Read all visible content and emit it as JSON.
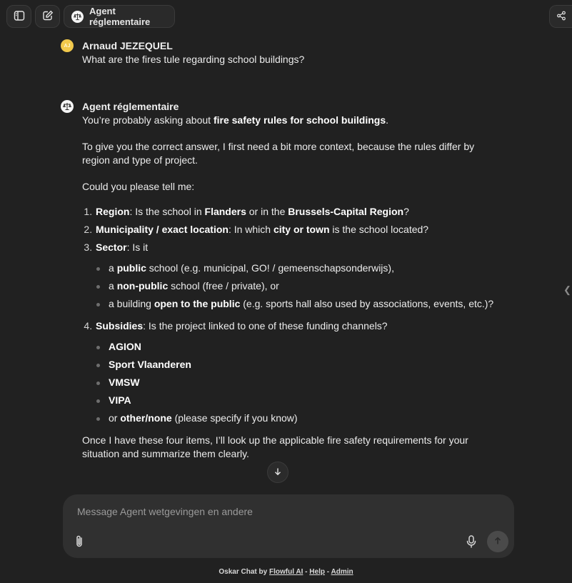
{
  "header": {
    "agent_name": "Agent réglementaire",
    "icons": {
      "sidebar": "sidebar-toggle-icon",
      "new_chat": "new-chat-icon",
      "agent": "scales-icon",
      "share": "share-icon"
    }
  },
  "messages": {
    "user": {
      "avatar_initials": "AJ",
      "author": "Arnaud JEZEQUEL",
      "text": "What are the fires tule regarding school buildings?"
    },
    "agent": {
      "author": "Agent réglementaire",
      "intro_pre": "You’re probably asking about ",
      "intro_bold": "fire safety rules for school buildings",
      "intro_post": ".",
      "context": "To give you the correct answer, I first need a bit more context, because the rules differ by region and type of project.",
      "ask": "Could you please tell me:",
      "q1": {
        "bold": "Region",
        "a": ": Is the school in ",
        "b1": "Flanders",
        "c": " or in the ",
        "b2": "Brussels-Capital Region",
        "d": "?"
      },
      "q2": {
        "bold": "Municipality / exact location",
        "a": ": In which ",
        "b1": "city or town",
        "c": " is the school located?"
      },
      "q3": {
        "bold": "Sector",
        "a": ": Is it",
        "opt1": {
          "pre": "a ",
          "bold": "public",
          "post": " school (e.g. municipal, GO! / gemeenschapsonderwijs),"
        },
        "opt2": {
          "pre": "a ",
          "bold": "non-public",
          "post": " school (free / private), or"
        },
        "opt3": {
          "pre": "a building ",
          "bold": "open to the public",
          "post": " (e.g. sports hall also used by associations, events, etc.)?"
        }
      },
      "q4": {
        "bold": "Subsidies",
        "a": ": Is the project linked to one of these funding channels?",
        "items": [
          "AGION",
          "Sport Vlaanderen",
          "VMSW",
          "VIPA"
        ],
        "last_pre": "or ",
        "last_bold": "other/none",
        "last_post": " (please specify if you know)"
      },
      "closing": "Once I have these four items, I’ll look up the applicable fire safety requirements for your situation and summarize them clearly."
    }
  },
  "composer": {
    "placeholder": "Message Agent wetgevingen en andere",
    "icons": {
      "attach": "paperclip-icon",
      "mic": "microphone-icon",
      "send": "arrow-up-icon",
      "scroll": "arrow-down-icon"
    }
  },
  "footer": {
    "prefix": "Oskar Chat by ",
    "link1": "Flowful AI",
    "sep1": " - ",
    "link2": "Help",
    "sep2": " - ",
    "link3": "Admin"
  }
}
